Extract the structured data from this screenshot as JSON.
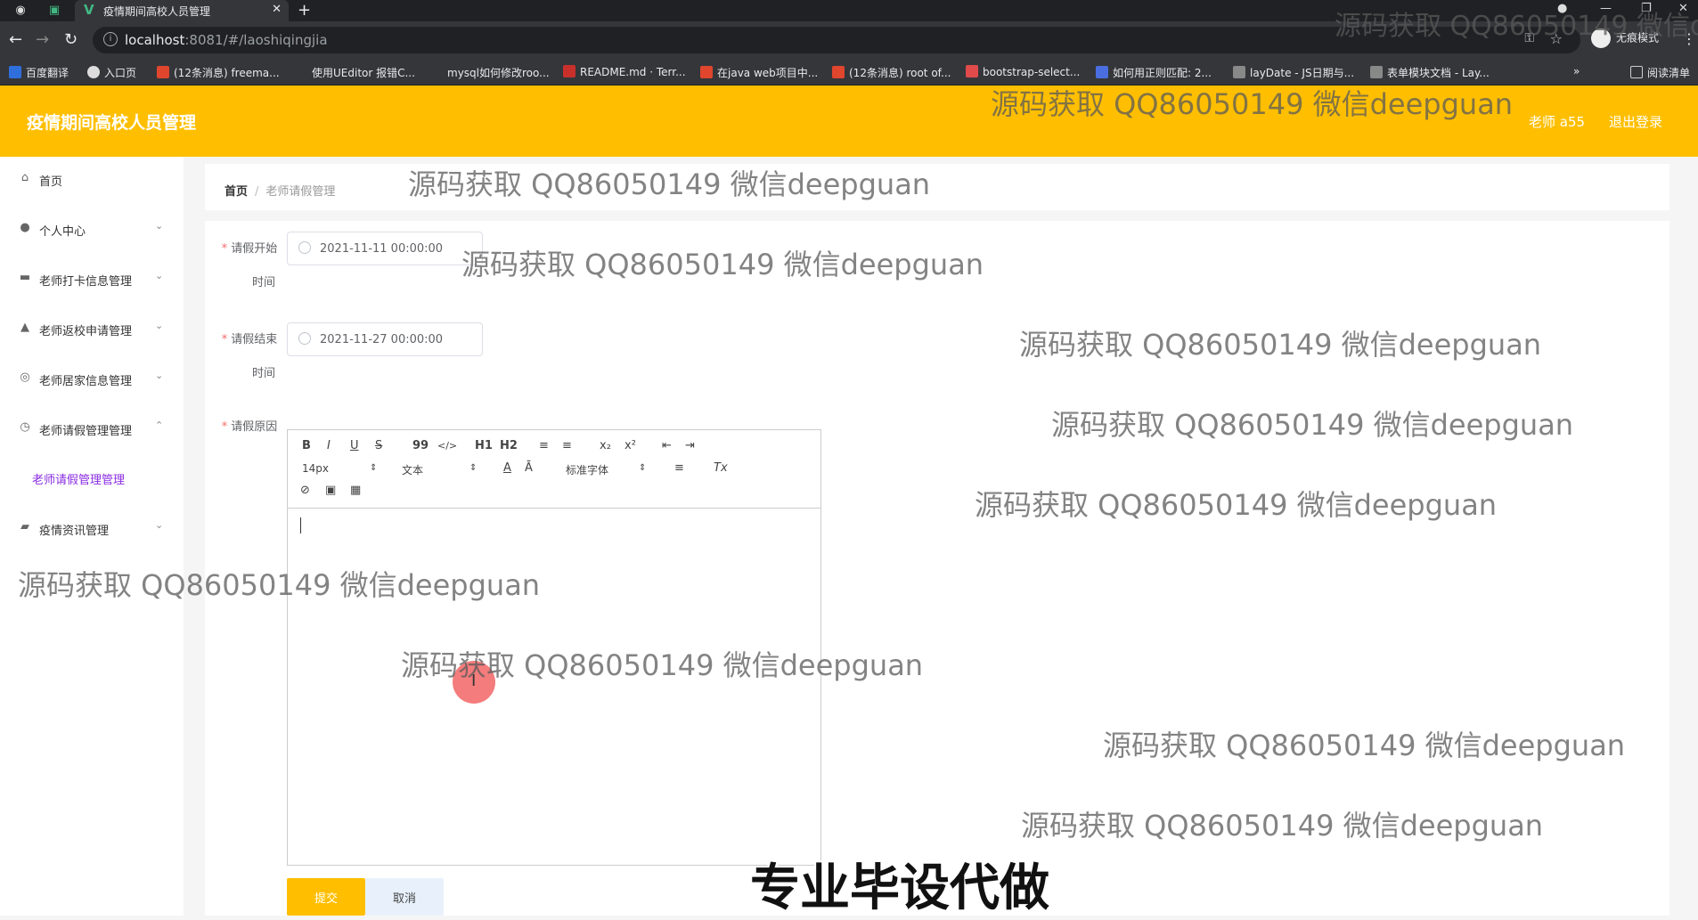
{
  "browser": {
    "tab_title": "疫情期间高校人员管理",
    "tab_favicon": "V",
    "url_host": "localhost",
    "url_rest": ":8081/#/laoshiqingjia",
    "incognito_label": "无痕模式",
    "bookmarks": [
      "百度翻译",
      "入口页",
      "(12条消息) freema...",
      "使用UEditor 报错C...",
      "mysql如何修改roo...",
      "README.md · Terr...",
      "在java web项目中...",
      "(12条消息) root of...",
      "bootstrap-select...",
      "如何用正则匹配: 2...",
      "layDate - JS日期与...",
      "表单模块文档 - Lay..."
    ],
    "reading_list": "阅读清单",
    "more": "»"
  },
  "header": {
    "title": "疫情期间高校人员管理",
    "user": "老师 a55",
    "logout": "退出登录"
  },
  "sidebar": {
    "items": [
      {
        "label": "首页",
        "icon": "home-icon"
      },
      {
        "label": "个人中心",
        "icon": "user-icon"
      },
      {
        "label": "老师打卡信息管理",
        "icon": "briefcase-icon"
      },
      {
        "label": "老师返校申请管理",
        "icon": "user-icon"
      },
      {
        "label": "老师居家信息管理",
        "icon": "globe-icon"
      },
      {
        "label": "老师请假管理管理",
        "icon": "compass-icon"
      },
      {
        "label": "疫情资讯管理",
        "icon": "news-icon"
      }
    ],
    "sub_item": "老师请假管理管理"
  },
  "breadcrumb": {
    "home": "首页",
    "sep": "/",
    "current": "老师请假管理"
  },
  "form": {
    "start_label_1": "请假开始",
    "start_label_2": "时间",
    "start_value": "2021-11-11 00:00:00",
    "end_label_1": "请假结束",
    "end_label_2": "时间",
    "end_value": "2021-11-27 00:00:00",
    "reason_label": "请假原因",
    "required_mark": "*",
    "submit": "提交",
    "cancel": "取消"
  },
  "editor": {
    "toolbar": {
      "bold": "B",
      "italic": "I",
      "underline": "U",
      "strike": "S",
      "quote": "99",
      "code": "</>",
      "h1": "H1",
      "h2": "H2",
      "ordered": "≡",
      "bullet": "≡",
      "sub": "x₂",
      "sup": "x²",
      "outdent": "⇤",
      "indent": "⇥",
      "size": "14px",
      "format": "文本",
      "font": "标准字体",
      "align": "≡",
      "clean": "Tx",
      "link": "🔗",
      "image": "▣",
      "video": "▦"
    }
  },
  "watermark": "源码获取 QQ86050149 微信deepguan",
  "watermark_partial": "源码获取 QQ86050149 微信d",
  "banner": "专业毕设代做"
}
